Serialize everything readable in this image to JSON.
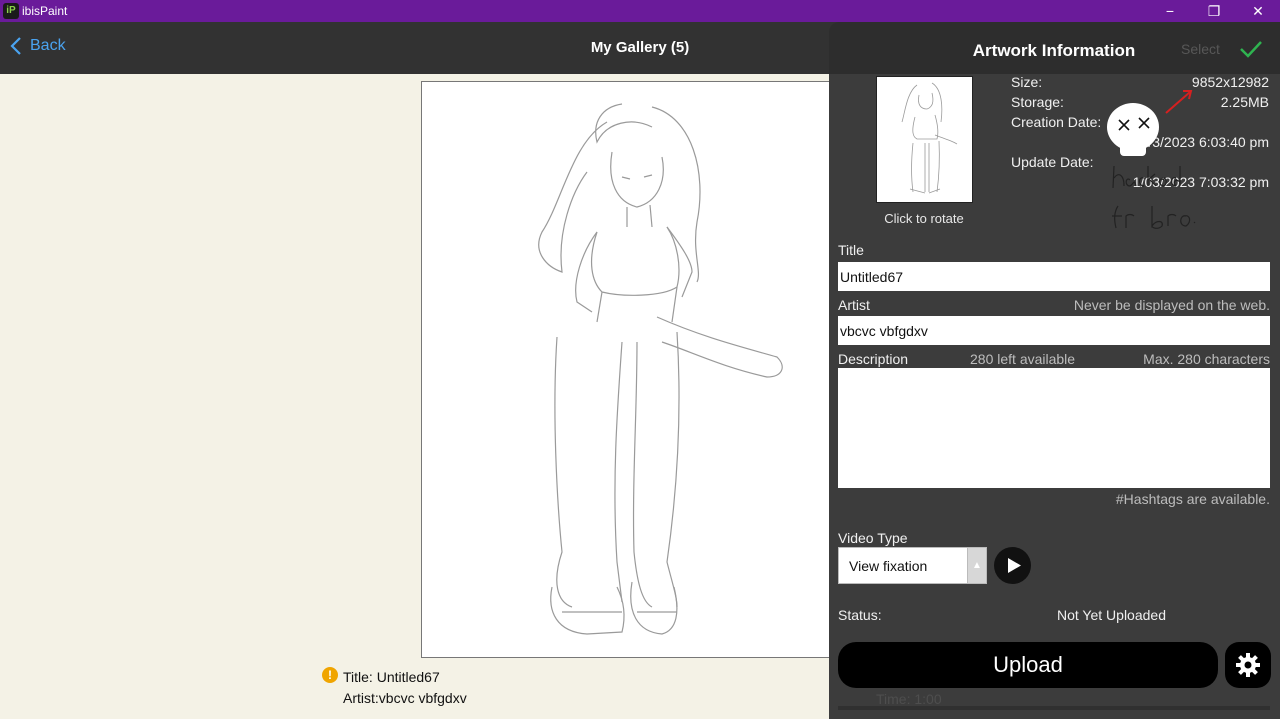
{
  "window": {
    "app_title": "ibisPaint",
    "app_icon_text": "iP",
    "minimize": "−",
    "restore": "❐",
    "close": "✕"
  },
  "header": {
    "back_label": "Back",
    "title": "My Gallery (5)",
    "ghost_icons": "+ ↑ ••"
  },
  "artwork": {
    "warning_icon": "!",
    "title_line": "Title: Untitled67",
    "artist_line": "Artist:vbcvc vbfgdxv"
  },
  "panel": {
    "title": "Artwork Information",
    "select_label": "Select",
    "thumbnail_caption": "Click to rotate",
    "meta": {
      "size_label": "Size:",
      "size_value": "9852x12982",
      "storage_label": "Storage:",
      "storage_value": "2.25MB",
      "creation_label": "Creation Date:",
      "creation_value": "/3/2023 6:03:40 pm",
      "update_label": "Update Date:",
      "update_value": "1/03/2023 7:03:32 pm"
    },
    "title_field": {
      "label": "Title",
      "value": "Untitled67"
    },
    "artist_field": {
      "label": "Artist",
      "note": "Never be displayed on the web.",
      "value": "vbcvc vbfgdxv"
    },
    "description_field": {
      "label": "Description",
      "left_note": "280 left available",
      "max_note": "Max. 280 characters",
      "value": ""
    },
    "hashtags_note": "#Hashtags are available.",
    "video_type": {
      "label": "Video Type",
      "selected": "View fixation",
      "arrow": "▲"
    },
    "status": {
      "label": "Status:",
      "value": "Not Yet Uploaded"
    },
    "upload_label": "Upload",
    "time_line": "Time:     1:00"
  },
  "annotation": {
    "handwritten_lines": [
      "hacked",
      "fr bro."
    ],
    "colors": {
      "arrow": "#d62020",
      "ink": "#222222",
      "skull": "#ffffff"
    }
  },
  "colors": {
    "titlebar": "#6a1b9a",
    "header": "#323232",
    "panel": "#3c3c3c",
    "accent_blue": "#4aa3f0",
    "check_green": "#2fb350",
    "canvas_bg": "#f4f2e6"
  }
}
